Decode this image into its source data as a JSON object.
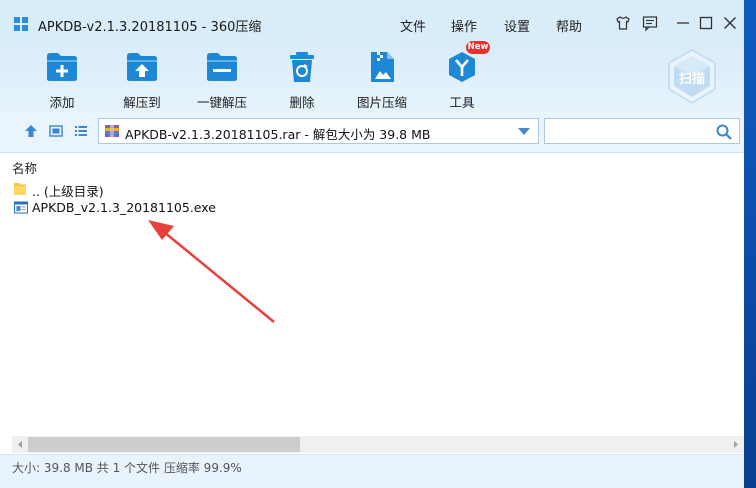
{
  "window": {
    "title": "APKDB-v2.1.3.20181105 - 360压缩",
    "menu": [
      "文件",
      "操作",
      "设置",
      "帮助"
    ]
  },
  "toolbar": {
    "add_label": "添加",
    "extract_to_label": "解压到",
    "one_click_extract_label": "一键解压",
    "delete_label": "删除",
    "image_compress_label": "图片压缩",
    "tools_label": "工具",
    "tools_badge": "New",
    "scan_label": "扫描"
  },
  "address": {
    "path_text": "APKDB-v2.1.3.20181105.rar - 解包大小为 39.8 MB",
    "search_value": ""
  },
  "list": {
    "column_name": "名称",
    "items": [
      {
        "name": ".. (上级目录)",
        "icon": "folder-icon"
      },
      {
        "name": "APKDB_v2.1.3_20181105.exe",
        "icon": "exe-file-icon"
      }
    ]
  },
  "status": {
    "text": "大小: 39.8 MB 共 1 个文件 压缩率 99.9%"
  },
  "colors": {
    "accent": "#1f88d6",
    "titlebar_bg": "#d9ecf9",
    "annotation_arrow": "#e8403a",
    "badge_red": "#e8312a"
  }
}
